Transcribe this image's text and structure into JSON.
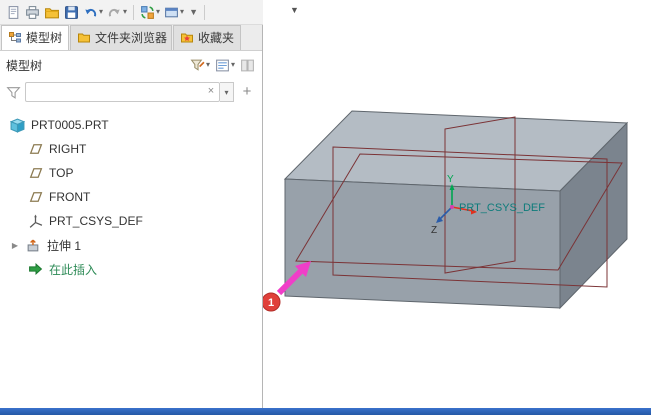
{
  "glyphs": {
    "caret": "▾",
    "overflow": "▼",
    "clear": "×",
    "plus": "+",
    "expander": "▶"
  },
  "toolbar": {
    "buttons": [
      {
        "name": "new"
      },
      {
        "name": "print"
      },
      {
        "name": "open"
      },
      {
        "name": "save"
      },
      {
        "name": "undo"
      },
      {
        "name": "redo"
      },
      {
        "name": "regenerate"
      },
      {
        "name": "windows"
      }
    ]
  },
  "tabs": [
    {
      "label": "模型树"
    },
    {
      "label": "文件夹浏览器"
    },
    {
      "label": "收藏夹"
    }
  ],
  "tree_header": {
    "title": "模型树"
  },
  "filter": {
    "value": "",
    "placeholder": ""
  },
  "tree": {
    "root_label": "PRT0005.PRT",
    "items": [
      {
        "label": "RIGHT",
        "icon": "datum-plane"
      },
      {
        "label": "TOP",
        "icon": "datum-plane"
      },
      {
        "label": "FRONT",
        "icon": "datum-plane"
      },
      {
        "label": "PRT_CSYS_DEF",
        "icon": "coordinate-system"
      },
      {
        "label": "拉伸 1",
        "icon": "extrude"
      },
      {
        "label": "在此插入",
        "icon": "insert-here"
      }
    ]
  },
  "viewport": {
    "csys_label": "PRT_CSYS_DEF",
    "axis_labels": {
      "y": "Y",
      "z": "Z"
    },
    "annotation": {
      "balloon": "1"
    }
  },
  "colors": {
    "balloon": "#e0403a",
    "annotation_arrow": "#f03ec8",
    "datum_plane": "#7b3336",
    "csys_label": "#0e7c7b",
    "bottom_bar": "#2a63be",
    "box_top": "#b4bcc4",
    "box_front": "#98a1aa",
    "box_right": "#7b848e"
  }
}
